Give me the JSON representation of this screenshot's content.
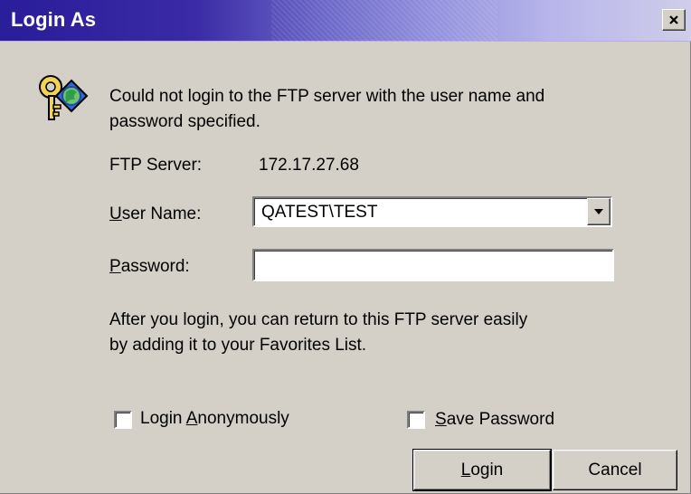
{
  "window": {
    "title": "Login As",
    "close_icon": "close-icon"
  },
  "message": {
    "line1": "Could not login to the FTP server with the user name and",
    "line2": "password specified."
  },
  "server": {
    "label": "FTP Server:",
    "value": "172.17.27.68"
  },
  "username": {
    "label_prefix": "",
    "label_mnemonic": "U",
    "label_suffix": "ser Name:",
    "value": "QATEST\\TEST"
  },
  "password": {
    "label_prefix": "",
    "label_mnemonic": "P",
    "label_suffix": "assword:",
    "value": ""
  },
  "info": {
    "line1": "After you login, you can return to this FTP server easily",
    "line2": "by adding it to your Favorites List."
  },
  "options": {
    "anonymous": {
      "label_prefix": "Login ",
      "label_mnemonic": "A",
      "label_suffix": "nonymously",
      "checked": false
    },
    "save_password": {
      "label_prefix": "",
      "label_mnemonic": "S",
      "label_suffix": "ave Password",
      "checked": false
    }
  },
  "buttons": {
    "login_prefix": "",
    "login_mnemonic": "L",
    "login_suffix": "ogin",
    "cancel": "Cancel"
  },
  "icons": {
    "key": "key-icon",
    "dropdown": "chevron-down-icon"
  },
  "colors": {
    "title_start": "#2a1d9a",
    "title_end": "#cfcde9",
    "dialog_bg": "#d4d0c8",
    "field_bg": "#ffffff"
  }
}
